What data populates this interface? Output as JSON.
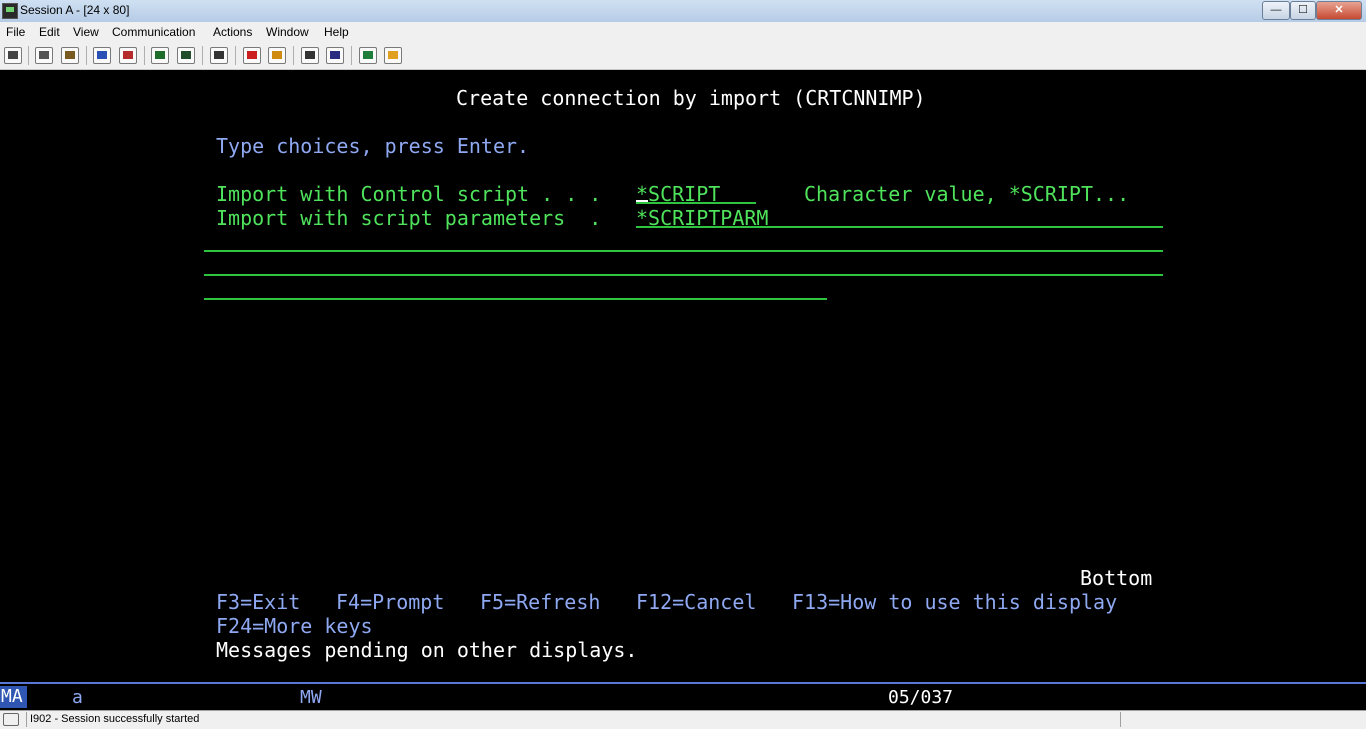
{
  "window": {
    "title": "Session A - [24 x 80]",
    "minimize_glyph": "—",
    "maximize_glyph": "☐",
    "close_glyph": "✕"
  },
  "menu": {
    "items": [
      "File",
      "Edit",
      "View",
      "Communication",
      "Actions",
      "Window",
      "Help"
    ]
  },
  "toolbar": {
    "icons": [
      "print-screen-icon",
      "copy-icon",
      "paste-icon",
      "send-icon",
      "receive-icon",
      "display-icon",
      "window-icon",
      "keyboard-icon",
      "macro-record-icon",
      "macro-stop-icon",
      "macro-play-icon",
      "macro-edit-icon",
      "globe-icon",
      "help-icon"
    ]
  },
  "screen": {
    "title": "Create connection by import (CRTCNNIMP)",
    "instruction": "Type choices, press Enter.",
    "fields": [
      {
        "label": "Import with Control script . . .",
        "value": "*SCRIPT",
        "hint": "Character value, *SCRIPT..."
      },
      {
        "label": "Import with script parameters  .",
        "value": "*SCRIPTPARM"
      }
    ],
    "bottom_label": "Bottom",
    "function_keys": [
      "F3=Exit",
      "F4=Prompt",
      "F5=Refresh",
      "F12=Cancel",
      "F13=How to use this display",
      "F24=More keys"
    ],
    "message": "Messages pending on other displays."
  },
  "oia": {
    "indicator": "MA",
    "mode": "a",
    "mw": "MW",
    "cursor_position": "05/037"
  },
  "status": {
    "message": "I902 - Session successfully started"
  },
  "colors": {
    "screen_background": "#000000",
    "field_green": "#4fe35c",
    "prompt_blue": "#8fa8f2",
    "text_white": "#ffffff"
  }
}
